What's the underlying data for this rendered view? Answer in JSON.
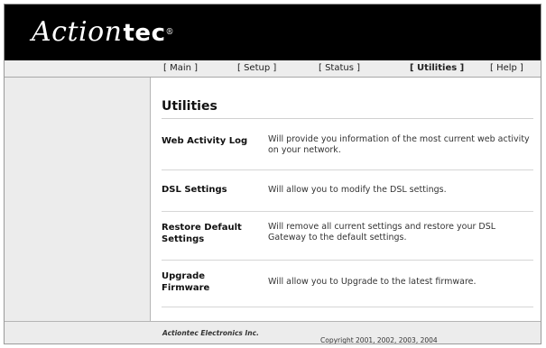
{
  "brand": {
    "logo_script": "Action",
    "logo_tec": "tec",
    "logo_reg": "®"
  },
  "nav": [
    {
      "label": "[ Main ]"
    },
    {
      "label": "[ Setup ]"
    },
    {
      "label": "[ Status ]"
    },
    {
      "label": "[ Utilities ]",
      "active": true
    },
    {
      "label": "[ Help ]"
    }
  ],
  "page": {
    "title": "Utilities"
  },
  "utilities": [
    {
      "label": "Web Activity Log",
      "description": "Will provide you information of the most current web activity on your network."
    },
    {
      "label": "DSL Settings",
      "description": "Will allow you to modify the DSL settings."
    },
    {
      "label": "Restore Default Settings",
      "description": "Will remove all current settings and restore your DSL Gateway to the default settings."
    },
    {
      "label": "Upgrade Firmware",
      "description": "Will allow you to Upgrade to the latest firmware."
    }
  ],
  "footer": {
    "copyright": "Copyright 2001, 2002, 2003, 2004",
    "company": "Actiontec Electronics Inc."
  },
  "colors": {
    "header_bg": "#000000",
    "nav_bg": "#ededed",
    "sidebar_bg": "#ececec"
  }
}
